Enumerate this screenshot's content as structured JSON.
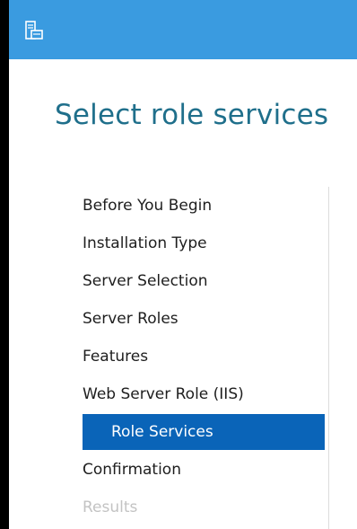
{
  "window": {
    "title_icon": "server-manager-icon"
  },
  "page": {
    "title": "Select role services"
  },
  "nav": {
    "items": [
      {
        "label": "Before You Begin",
        "state": "normal"
      },
      {
        "label": "Installation Type",
        "state": "normal"
      },
      {
        "label": "Server Selection",
        "state": "normal"
      },
      {
        "label": "Server Roles",
        "state": "normal"
      },
      {
        "label": "Features",
        "state": "normal"
      },
      {
        "label": "Web Server Role (IIS)",
        "state": "normal"
      },
      {
        "label": "Role Services",
        "state": "active"
      },
      {
        "label": "Confirmation",
        "state": "normal"
      },
      {
        "label": "Results",
        "state": "disabled"
      }
    ]
  },
  "colors": {
    "titlebar": "#3a9be0",
    "title_text": "#1f6f8b",
    "active_item_bg": "#0a64b8",
    "active_item_text": "#ffffff",
    "disabled_text": "#c3c3c3"
  }
}
